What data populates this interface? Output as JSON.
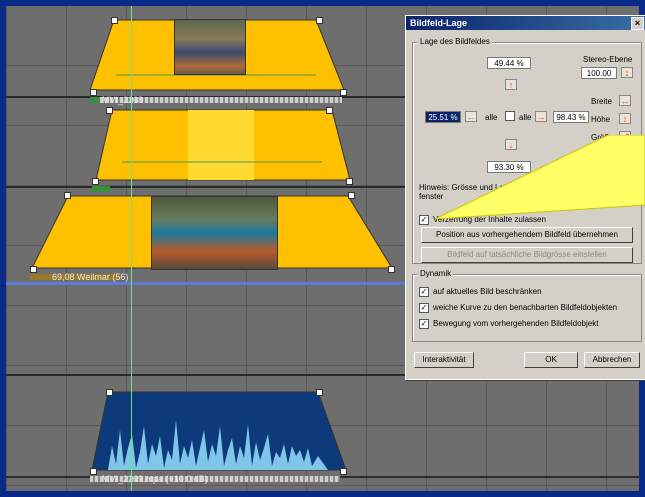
{
  "timeline": {
    "clip1_label": "MVI_2268",
    "clip2_label": "",
    "clip3_label": "69,08 Weilmar (56)",
    "audio_label": "MVI_2269.mpa (+10.0 dB)"
  },
  "dialog": {
    "title": "Bildfeld-Lage",
    "close_glyph": "×",
    "position_group_label": "Lage des Bildfeldes",
    "top_value": "49.44 %",
    "left_value": "25.51 %",
    "right_value": "98.43 %",
    "bottom_value": "93.30 %",
    "center_left_label": "alle",
    "center_right_label": "alle",
    "stereo_label": "Stereo-Ebene",
    "stereo_value": "100.00",
    "width_label": "Breite",
    "height_label": "Höhe",
    "size_label": "Größe",
    "hint_text": "Hinweis: Grösse und Lage ... mit der Maus am ... fenster",
    "distort_label": "Verzerrung der Inhalte zulassen",
    "prev_position_button": "Position aus vorhergehendem Bildfeld übernehmen",
    "actual_size_button": "Bildfeld auf tatsächliche Bildgrösse einstellen",
    "dynamics_group_label": "Dynamik",
    "dyn_opt1": "auf aktuelles Bild beschränken",
    "dyn_opt2": "weiche Kurve zu den benachbarten Bildfeldobjekten",
    "dyn_opt3": "Bewegung vom vorhergehenden Bildfeldobjekt",
    "interactivity_button": "Interaktivität",
    "ok_button": "OK",
    "cancel_button": "Abbrechen"
  },
  "colors": {
    "clip_yellow": "#ffc000",
    "audio_blue": "#0d3a7a",
    "dialog_title": "#0a246a",
    "callout": "#ffff66"
  }
}
